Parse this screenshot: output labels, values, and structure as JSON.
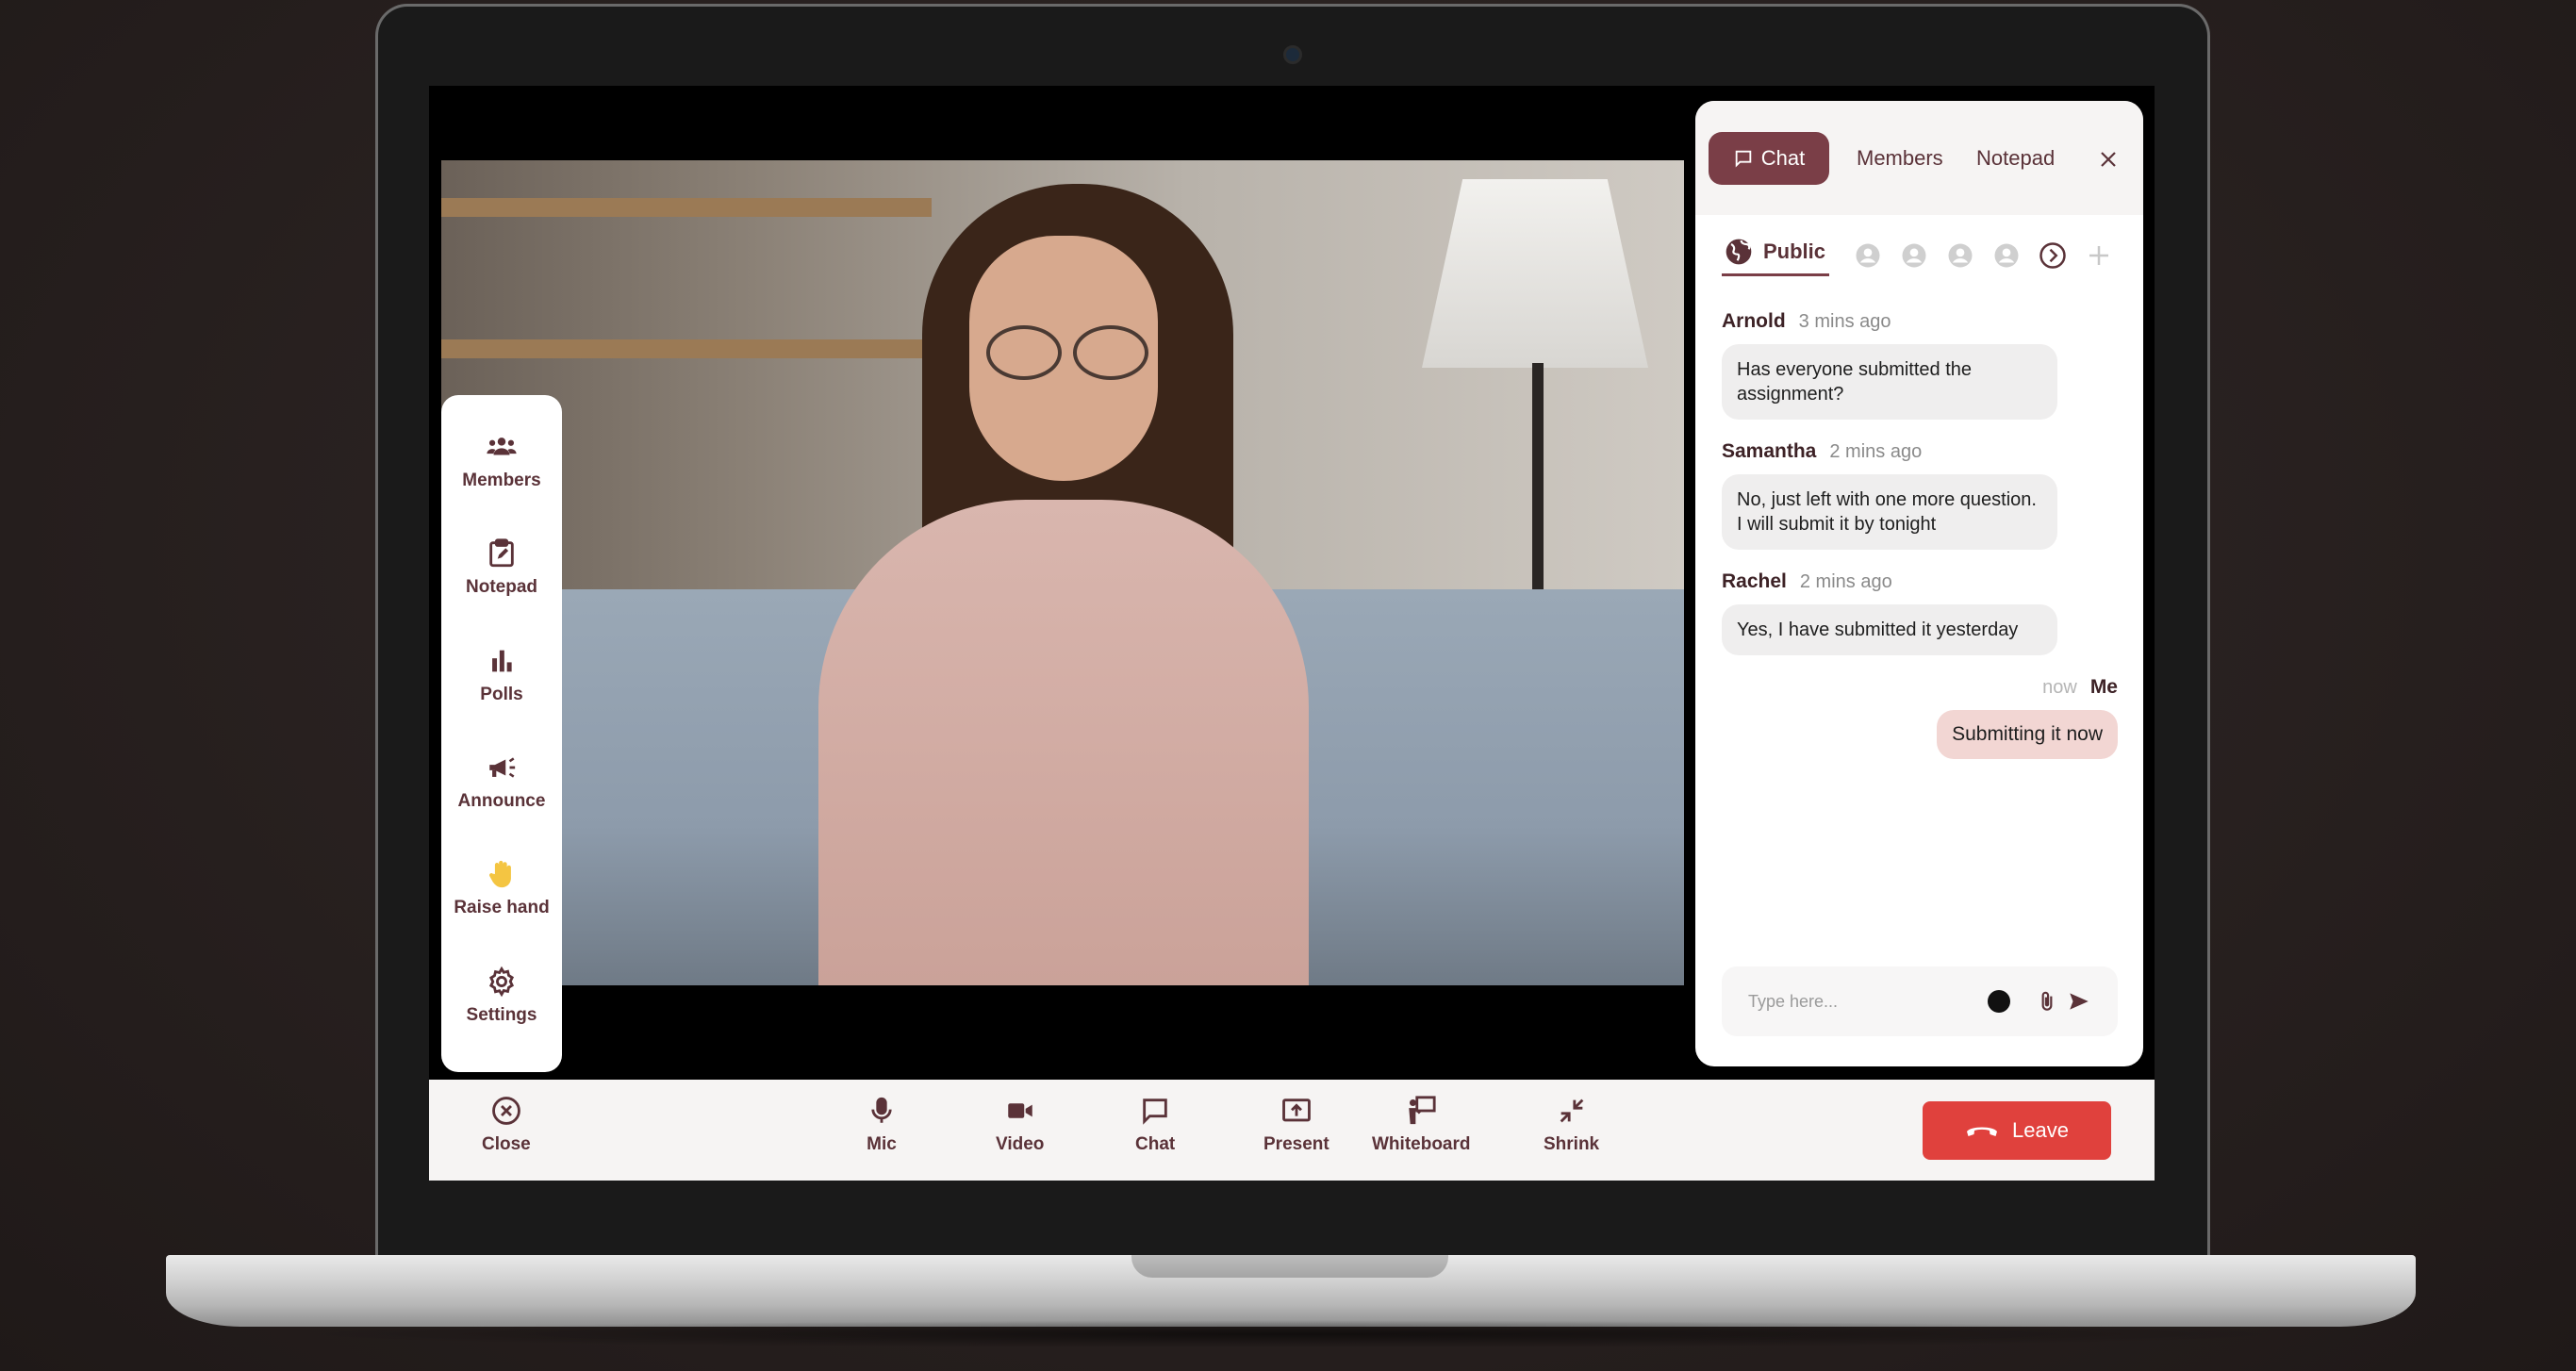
{
  "left_toolbar": {
    "items": [
      {
        "label": "Members",
        "icon": "members-icon"
      },
      {
        "label": "Notepad",
        "icon": "notepad-icon"
      },
      {
        "label": "Polls",
        "icon": "polls-icon"
      },
      {
        "label": "Announce",
        "icon": "megaphone-icon"
      },
      {
        "label": "Raise hand",
        "icon": "hand-icon"
      },
      {
        "label": "Settings",
        "icon": "gear-icon"
      }
    ]
  },
  "chat_panel": {
    "tabs": {
      "chat": "Chat",
      "members": "Members",
      "notepad": "Notepad"
    },
    "recipients": {
      "public_label": "Public"
    },
    "messages": [
      {
        "name": "Arnold",
        "time": "3 mins ago",
        "text": "Has everyone submitted the assignment?"
      },
      {
        "name": "Samantha",
        "time": "2 mins ago",
        "text": "No, just left with one more question. I will submit it by tonight"
      },
      {
        "name": "Rachel",
        "time": "2 mins ago",
        "text": "Yes, I have submitted it yesterday"
      }
    ],
    "my_message": {
      "name": "Me",
      "time": "now",
      "text": "Submitting it now"
    },
    "composer": {
      "placeholder": "Type here...",
      "value": ""
    }
  },
  "bottom_bar": {
    "close": "Close",
    "mic": "Mic",
    "video": "Video",
    "chat": "Chat",
    "present": "Present",
    "whiteboard": "Whiteboard",
    "shrink": "Shrink",
    "leave": "Leave"
  },
  "colors": {
    "accent": "#7a3e47",
    "leave": "#e0413d",
    "my_bubble": "#f2d6d3",
    "bubble": "#efeeee",
    "panel_header": "#f6f4f3"
  }
}
